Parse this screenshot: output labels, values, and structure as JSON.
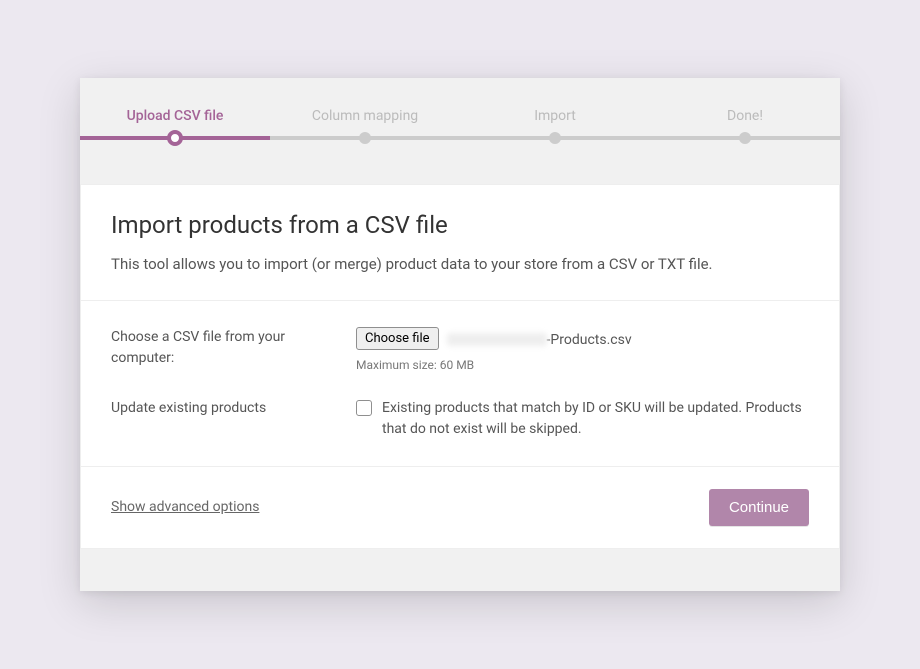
{
  "stepper": {
    "steps": [
      {
        "label": "Upload CSV file",
        "active": true
      },
      {
        "label": "Column mapping",
        "active": false
      },
      {
        "label": "Import",
        "active": false
      },
      {
        "label": "Done!",
        "active": false
      }
    ]
  },
  "card": {
    "title": "Import products from a CSV file",
    "description": "This tool allows you to import (or merge) product data to your store from a CSV or TXT file."
  },
  "form": {
    "file_field": {
      "label": "Choose a CSV file from your computer:",
      "button_label": "Choose file",
      "selected_suffix": "-Products.csv",
      "hint": "Maximum size: 60 MB"
    },
    "update_field": {
      "label": "Update existing products",
      "checked": false,
      "description": "Existing products that match by ID or SKU will be updated. Products that do not exist will be skipped."
    }
  },
  "footer": {
    "advanced_link": "Show advanced options",
    "continue_label": "Continue"
  }
}
